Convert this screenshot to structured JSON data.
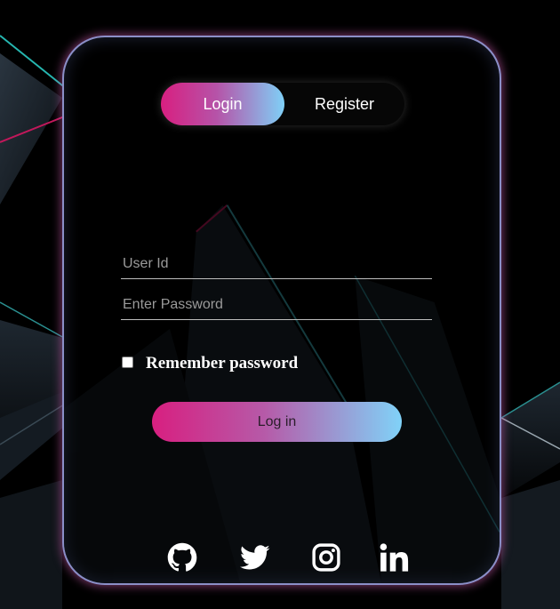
{
  "tabs": {
    "login_label": "Login",
    "register_label": "Register"
  },
  "form": {
    "user_placeholder": "User Id",
    "user_value": "",
    "password_placeholder": "Enter Password",
    "password_value": "",
    "remember_label": "Remember password",
    "remember_checked": false,
    "submit_label": "Log in"
  },
  "socials": [
    {
      "icon": "github-icon"
    },
    {
      "icon": "twitter-icon"
    },
    {
      "icon": "instagram-icon"
    },
    {
      "icon": "linkedin-icon"
    }
  ],
  "colors": {
    "gradient_start": "#d81f80",
    "gradient_end": "#80d2f8",
    "card_border": "#8b8fc8",
    "background": "#000000"
  }
}
